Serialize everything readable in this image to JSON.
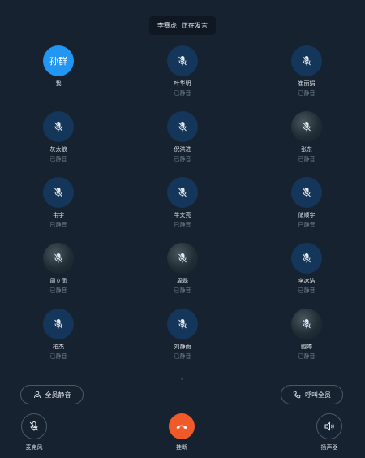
{
  "banner": {
    "speaker_name": "李赛虎",
    "speaking_text": "正在发言"
  },
  "self": {
    "avatar_text": "孙群",
    "name": "我"
  },
  "participants": [
    {
      "name": "叶华明",
      "status": "已静音",
      "avatar": "mic-muted"
    },
    {
      "name": "崔丽娟",
      "status": "已静音",
      "avatar": "mic-muted"
    },
    {
      "name": "灰太狼",
      "status": "已静音",
      "avatar": "mic-muted"
    },
    {
      "name": "倪洪进",
      "status": "已静音",
      "avatar": "mic-muted"
    },
    {
      "name": "张东",
      "status": "已静音",
      "avatar": "photo"
    },
    {
      "name": "韦宇",
      "status": "已静音",
      "avatar": "mic-muted"
    },
    {
      "name": "牛文亮",
      "status": "已静音",
      "avatar": "mic-muted"
    },
    {
      "name": "储顺宇",
      "status": "已静音",
      "avatar": "mic-muted"
    },
    {
      "name": "周立凤",
      "status": "已静音",
      "avatar": "photo"
    },
    {
      "name": "周磊",
      "status": "已静音",
      "avatar": "photo"
    },
    {
      "name": "李冰洁",
      "status": "已静音",
      "avatar": "mic-muted"
    },
    {
      "name": "柏杰",
      "status": "已静音",
      "avatar": "mic-muted"
    },
    {
      "name": "刘静雨",
      "status": "已静音",
      "avatar": "mic-muted"
    },
    {
      "name": "鲍婷",
      "status": "已静音",
      "avatar": "photo"
    }
  ],
  "actions": {
    "mute_all": "全员静音",
    "call_all": "呼叫全员"
  },
  "controls": {
    "microphone": "麦克风",
    "hangup": "挂断",
    "speaker": "扬声器"
  },
  "colors": {
    "background": "#172230",
    "avatar_bg": "#14365a",
    "self_avatar": "#2196f3",
    "hangup": "#f05a28"
  }
}
